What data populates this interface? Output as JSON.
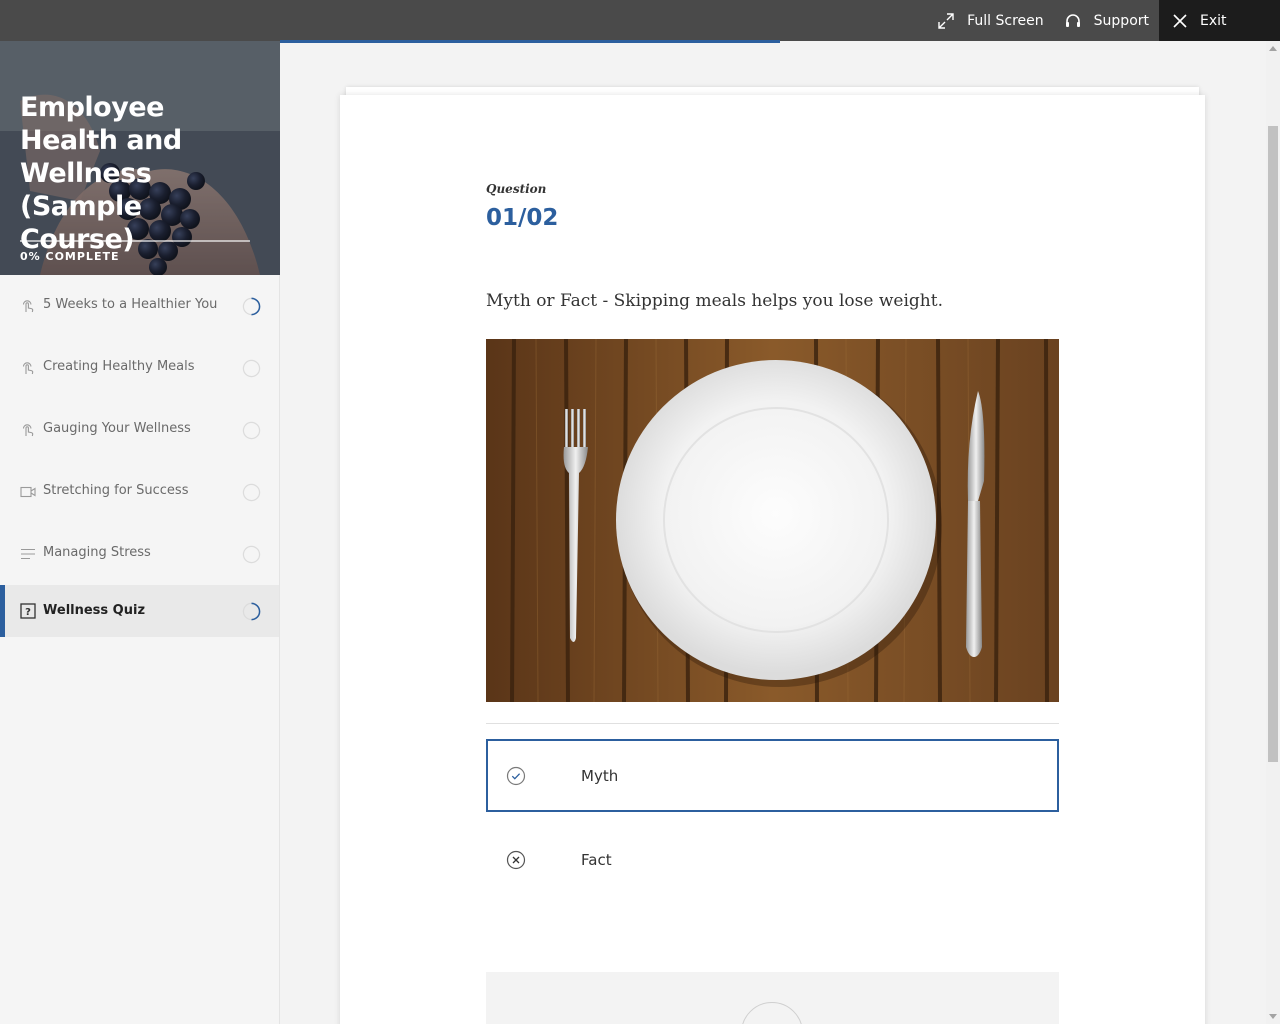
{
  "topbar": {
    "fullscreen_label": "Full Screen",
    "support_label": "Support",
    "exit_label": "Exit",
    "progress_fraction": 0.5
  },
  "course": {
    "title": "Employee Health and Wellness (Sample Course)",
    "progress_label": "0% COMPLETE"
  },
  "lessons": [
    {
      "label": "5 Weeks to a Healthier You",
      "icon": "hand-touch-icon",
      "status": "in-progress"
    },
    {
      "label": "Creating Healthy Meals",
      "icon": "hand-touch-icon",
      "status": "not-started"
    },
    {
      "label": "Gauging Your Wellness",
      "icon": "hand-touch-icon",
      "status": "not-started"
    },
    {
      "label": "Stretching for Success",
      "icon": "video-icon",
      "status": "not-started"
    },
    {
      "label": "Managing Stress",
      "icon": "text-lines-icon",
      "status": "not-started"
    },
    {
      "label": "Wellness Quiz",
      "icon": "question-icon",
      "status": "in-progress",
      "active": true
    }
  ],
  "quiz": {
    "question_label": "Question",
    "question_number": "01/02",
    "question_text": "Myth or Fact - Skipping meals helps you lose weight.",
    "choices": [
      {
        "label": "Myth",
        "icon": "check-circle-icon",
        "selected": true
      },
      {
        "label": "Fact",
        "icon": "x-circle-icon",
        "selected": false
      }
    ]
  },
  "colors": {
    "accent": "#2c5f9e",
    "topbar": "#4a4a4a",
    "exit_bg": "#1c1c1c"
  }
}
